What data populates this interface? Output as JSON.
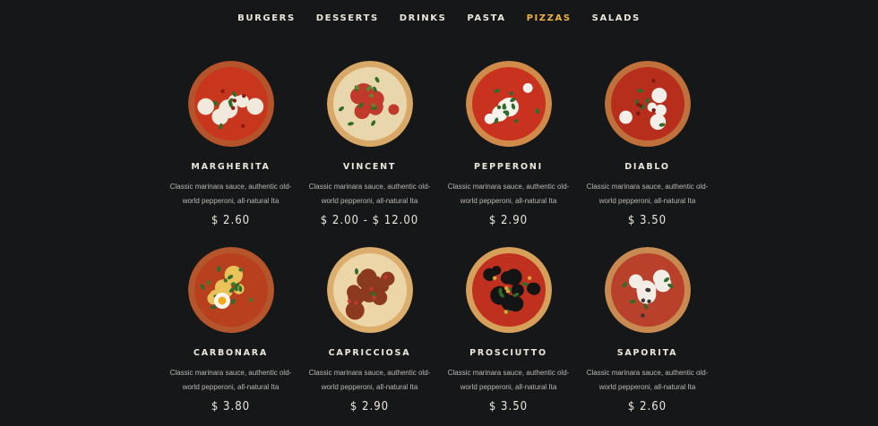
{
  "nav": {
    "items": [
      "BURGERS",
      "DESSERTS",
      "DRINKS",
      "PASTA",
      "PIZZAS",
      "SALADS"
    ],
    "active_index": 4,
    "active_color": "#f0b43c"
  },
  "menu": {
    "items": [
      {
        "name": "MARGHERITA",
        "desc": "Classic marinara sauce, authentic old-world pepperoni, all-natural Ita",
        "price": "$ 2.60",
        "image": "pizza-margherita-image"
      },
      {
        "name": "VINCENT",
        "desc": "Classic marinara sauce, authentic old-world pepperoni, all-natural Ita",
        "price": "$ 2.00 - $ 12.00",
        "image": "pizza-vincent-image"
      },
      {
        "name": "PEPPERONI",
        "desc": "Classic marinara sauce, authentic old-world pepperoni, all-natural Ita",
        "price": "$ 2.90",
        "image": "pizza-pepperoni-image"
      },
      {
        "name": "DIABLO",
        "desc": "Classic marinara sauce, authentic old-world pepperoni, all-natural Ita",
        "price": "$ 3.50",
        "image": "pizza-diablo-image"
      },
      {
        "name": "CARBONARA",
        "desc": "Classic marinara sauce, authentic old-world pepperoni, all-natural Ita",
        "price": "$ 3.80",
        "image": "pizza-carbonara-image"
      },
      {
        "name": "CAPRICCIOSA",
        "desc": "Classic marinara sauce, authentic old-world pepperoni, all-natural Ita",
        "price": "$ 2.90",
        "image": "pizza-capricciosa-image"
      },
      {
        "name": "PROSCIUTTO",
        "desc": "Classic marinara sauce, authentic old-world pepperoni, all-natural Ita",
        "price": "$ 3.50",
        "image": "pizza-prosciutto-image"
      },
      {
        "name": "SAPORITA",
        "desc": "Classic marinara sauce, authentic old-world pepperoni, all-natural Ita",
        "price": "$ 2.60",
        "image": "pizza-saporita-image"
      }
    ]
  }
}
